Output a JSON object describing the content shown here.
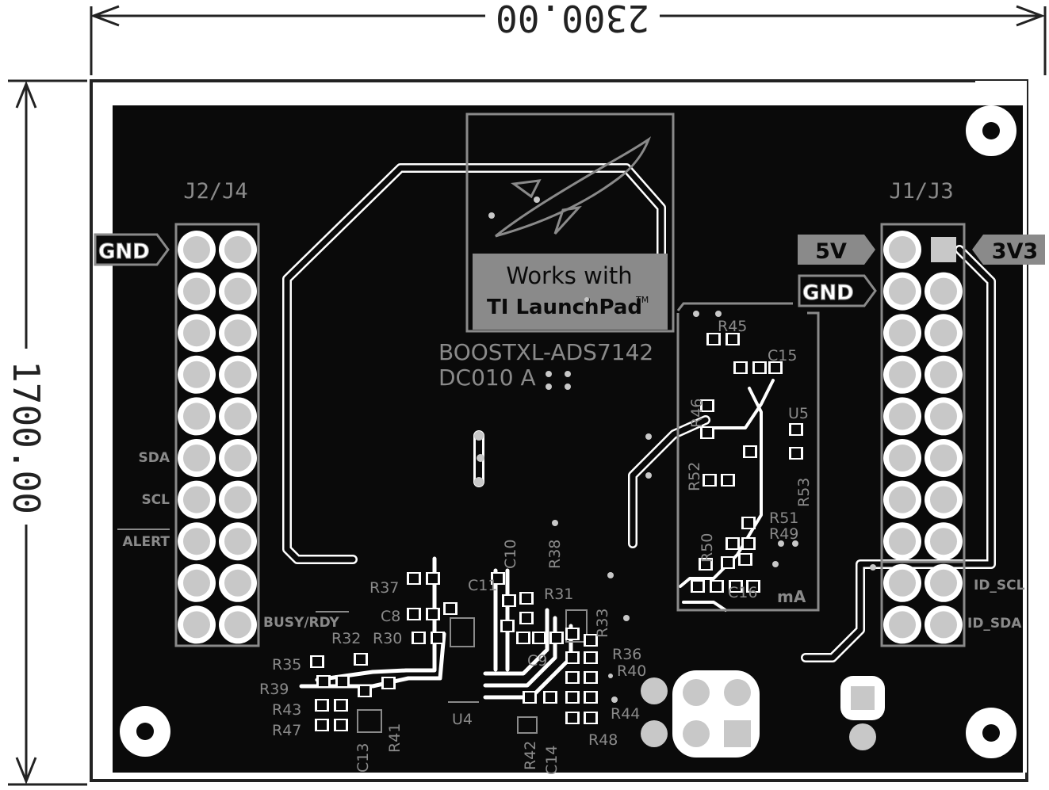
{
  "dimensions": {
    "width_label": "2300.00",
    "height_label": "1700.00"
  },
  "board": {
    "name": "BOOSTXL-ADS7142",
    "revision": "DC010 A",
    "logo_line1": "Works with",
    "logo_line2": "TI LaunchPad",
    "logo_tm": "TM"
  },
  "headers": {
    "left": "J2/J4",
    "right": "J1/J3"
  },
  "pin_labels": {
    "gnd_left": "GND",
    "gnd_right": "GND",
    "v5": "5V",
    "v3v3": "3V3",
    "sda": "SDA",
    "scl": "SCL",
    "alert": "ALERT",
    "busy_rdy": "BUSY/RDY",
    "id_scl": "ID_SCL",
    "id_sda": "ID_SDA",
    "ma": "mA"
  },
  "components": {
    "r45": "R45",
    "c15": "C15",
    "u5": "U5",
    "r46": "R46",
    "r52": "R52",
    "r53": "R53",
    "r51": "R51",
    "r49": "R49",
    "r50": "R50",
    "c16": "C16",
    "r37": "R37",
    "c8": "C8",
    "c11": "C11",
    "c10": "C10",
    "r38": "R38",
    "r31": "R31",
    "r33": "R33",
    "r32": "R32",
    "r30": "R30",
    "r35": "R35",
    "r39": "R39",
    "r43": "R43",
    "r47": "R47",
    "r41": "R41",
    "c13": "C13",
    "u4": "U4",
    "c9": "C9",
    "r36": "R36",
    "r40": "R40",
    "r44": "R44",
    "r48": "R48",
    "r42": "R42",
    "c14": "C14"
  },
  "colors": {
    "board": "#0a0a0a",
    "pad": "#c8c8c8",
    "trace": "#ffffff",
    "silk": "#8a8a8a",
    "dim_line": "#222222"
  }
}
